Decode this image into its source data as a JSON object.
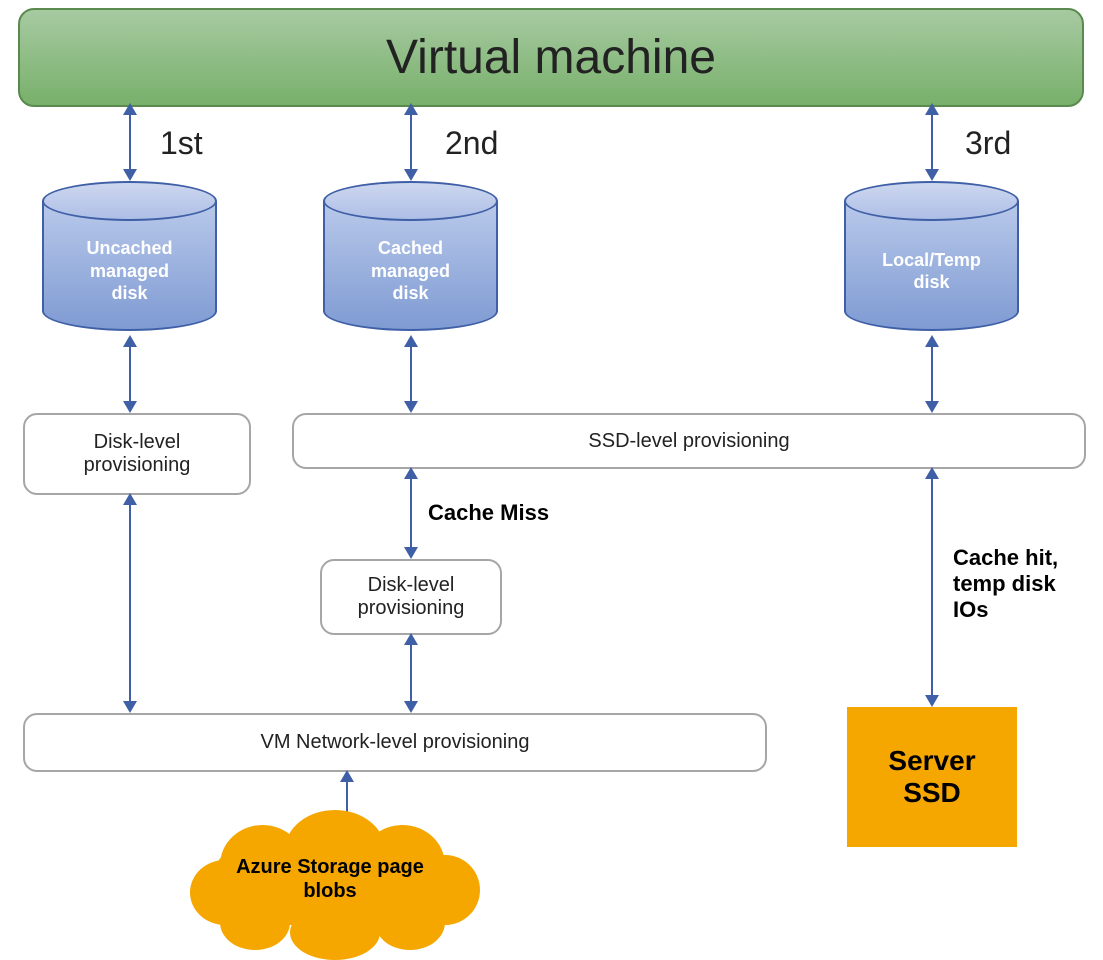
{
  "vm_title": "Virtual machine",
  "orders": {
    "first": "1st",
    "second": "2nd",
    "third": "3rd"
  },
  "disks": {
    "uncached": "Uncached managed disk",
    "cached": "Cached managed disk",
    "local": "Local/Temp disk"
  },
  "boxes": {
    "disk_level_left": "Disk-level provisioning",
    "ssd_level": "SSD-level provisioning",
    "disk_level_mid": "Disk-level provisioning",
    "vm_network": "VM Network-level provisioning"
  },
  "notes": {
    "cache_miss": "Cache Miss",
    "cache_hit": "Cache hit, temp disk IOs"
  },
  "cloud_label": "Azure Storage page blobs",
  "ssd": {
    "line1": "Server",
    "line2": "SSD"
  }
}
